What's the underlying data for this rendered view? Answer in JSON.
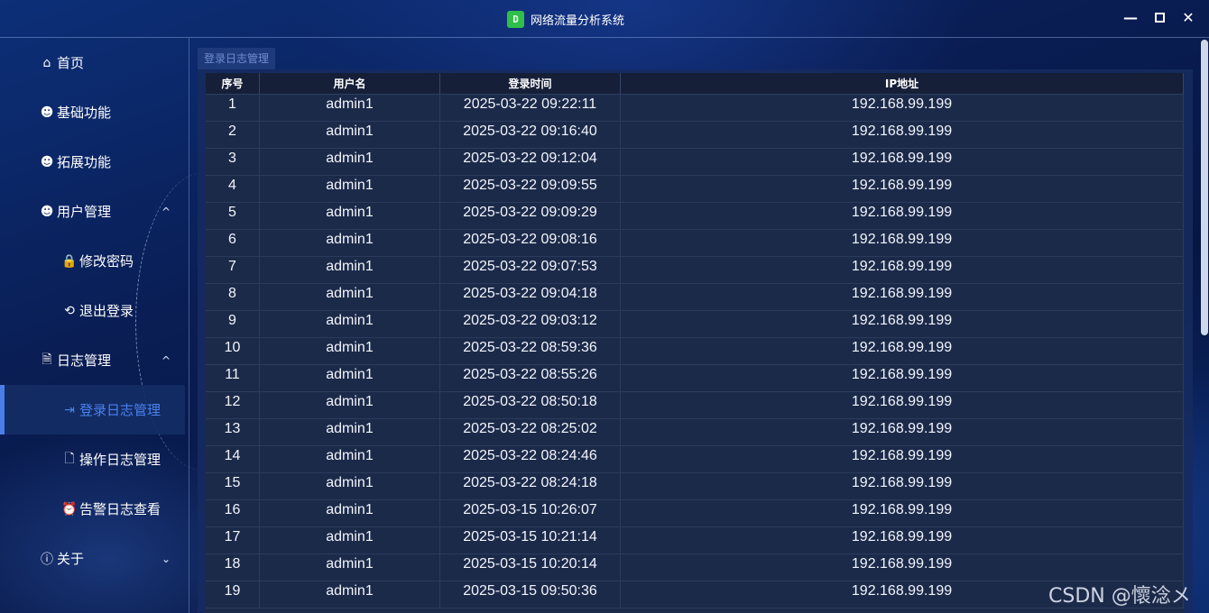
{
  "window": {
    "title": "网络流量分析系统",
    "logo_text": "D"
  },
  "sidebar": {
    "items": [
      {
        "label": "首页",
        "icon": "home-icon",
        "glyph": "⌂"
      },
      {
        "label": "基础功能",
        "icon": "user-circle-icon",
        "glyph": "☻"
      },
      {
        "label": "拓展功能",
        "icon": "user-circle-icon",
        "glyph": "☻"
      },
      {
        "label": "用户管理",
        "icon": "user-circle-icon",
        "glyph": "☻",
        "chevron": "^"
      },
      {
        "label": "修改密码",
        "icon": "lock-icon",
        "glyph": "🔒"
      },
      {
        "label": "退出登录",
        "icon": "logout-icon",
        "glyph": "⟲"
      },
      {
        "label": "日志管理",
        "icon": "log-search-icon",
        "glyph": "🗎",
        "chevron": "^"
      },
      {
        "label": "登录日志管理",
        "icon": "login-log-icon",
        "glyph": "⇥"
      },
      {
        "label": "操作日志管理",
        "icon": "file-settings-icon",
        "glyph": "🗋"
      },
      {
        "label": "告警日志查看",
        "icon": "alarm-icon",
        "glyph": "⏰"
      },
      {
        "label": "关于",
        "icon": "info-icon",
        "glyph": "ⓘ",
        "chevron": "⌄"
      }
    ]
  },
  "tab": {
    "label": "登录日志管理"
  },
  "table": {
    "columns": [
      "序号",
      "用户名",
      "登录时间",
      "IP地址"
    ],
    "rows": [
      [
        "1",
        "admin1",
        "2025-03-22 09:22:11",
        "192.168.99.199"
      ],
      [
        "2",
        "admin1",
        "2025-03-22 09:16:40",
        "192.168.99.199"
      ],
      [
        "3",
        "admin1",
        "2025-03-22 09:12:04",
        "192.168.99.199"
      ],
      [
        "4",
        "admin1",
        "2025-03-22 09:09:55",
        "192.168.99.199"
      ],
      [
        "5",
        "admin1",
        "2025-03-22 09:09:29",
        "192.168.99.199"
      ],
      [
        "6",
        "admin1",
        "2025-03-22 09:08:16",
        "192.168.99.199"
      ],
      [
        "7",
        "admin1",
        "2025-03-22 09:07:53",
        "192.168.99.199"
      ],
      [
        "8",
        "admin1",
        "2025-03-22 09:04:18",
        "192.168.99.199"
      ],
      [
        "9",
        "admin1",
        "2025-03-22 09:03:12",
        "192.168.99.199"
      ],
      [
        "10",
        "admin1",
        "2025-03-22 08:59:36",
        "192.168.99.199"
      ],
      [
        "11",
        "admin1",
        "2025-03-22 08:55:26",
        "192.168.99.199"
      ],
      [
        "12",
        "admin1",
        "2025-03-22 08:50:18",
        "192.168.99.199"
      ],
      [
        "13",
        "admin1",
        "2025-03-22 08:25:02",
        "192.168.99.199"
      ],
      [
        "14",
        "admin1",
        "2025-03-22 08:24:46",
        "192.168.99.199"
      ],
      [
        "15",
        "admin1",
        "2025-03-22 08:24:18",
        "192.168.99.199"
      ],
      [
        "16",
        "admin1",
        "2025-03-15 10:26:07",
        "192.168.99.199"
      ],
      [
        "17",
        "admin1",
        "2025-03-15 10:21:14",
        "192.168.99.199"
      ],
      [
        "18",
        "admin1",
        "2025-03-15 10:20:14",
        "192.168.99.199"
      ],
      [
        "19",
        "admin1",
        "2025-03-15 09:50:36",
        "192.168.99.199"
      ]
    ]
  },
  "watermark": "CSDN @懷淰メ",
  "colors": {
    "accent": "#4a7de8",
    "background": "#0a1e55",
    "grid": "#1c2a4a"
  }
}
